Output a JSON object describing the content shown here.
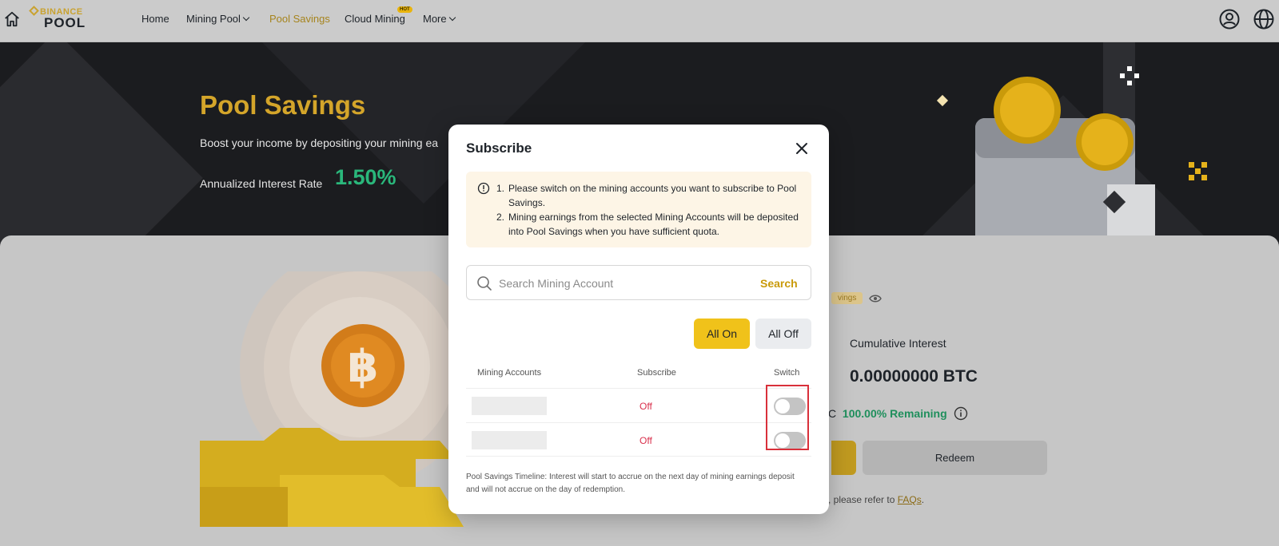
{
  "nav": {
    "logo_top": "BINANCE",
    "logo_bottom": "POOL",
    "items": [
      {
        "label": "Home"
      },
      {
        "label": "Mining Pool"
      },
      {
        "label": "Pool Savings"
      },
      {
        "label": "Cloud Mining",
        "badge": "HOT"
      },
      {
        "label": "More"
      }
    ]
  },
  "hero": {
    "title": "Pool Savings",
    "subtitle": "Boost your income by depositing your mining ea",
    "rate_label": "Annualized Interest Rate",
    "rate_value": "1.50%"
  },
  "background": {
    "savings_tag": "vings",
    "cumulative_label": "Cumulative Interest",
    "cumulative_value": "0.00000000 BTC",
    "remaining_prefix": "C",
    "remaining_pct": "100.00% Remaining",
    "redeem_label": "Redeem",
    "faq_text": "s, please refer to",
    "faq_link": "FAQs",
    "faq_end": "."
  },
  "modal": {
    "title": "Subscribe",
    "notice": [
      {
        "num": "1.",
        "text": "Please switch on the mining accounts you want to subscribe to Pool Savings."
      },
      {
        "num": "2.",
        "text": "Mining earnings from the selected Mining Accounts will be deposited into Pool Savings when you have sufficient quota."
      }
    ],
    "search": {
      "placeholder": "Search Mining Account",
      "button": "Search"
    },
    "all_on": "All On",
    "all_off": "All Off",
    "table": {
      "headers": {
        "account": "Mining Accounts",
        "subscribe": "Subscribe",
        "switch": "Switch"
      },
      "rows": [
        {
          "account": "",
          "subscribe": "Off",
          "switch_on": false
        },
        {
          "account": "",
          "subscribe": "Off",
          "switch_on": false
        }
      ]
    },
    "footer": "Pool Savings Timeline: Interest will start to accrue on the next day of mining earnings deposit and will not accrue on the day of redemption."
  },
  "colors": {
    "brand_gold": "#F0C21A",
    "rate_green": "#2AB77B",
    "off_red": "#D9304C",
    "highlight_red": "#D9303A"
  }
}
